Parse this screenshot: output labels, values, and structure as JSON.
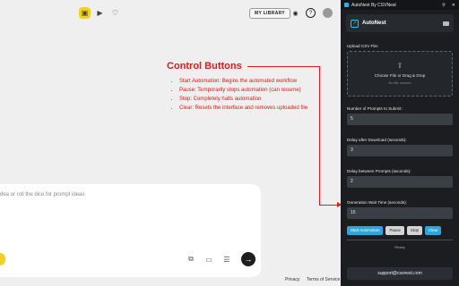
{
  "header": {
    "library_label": "MY LIBRARY"
  },
  "annotation": {
    "title": "Control Buttons",
    "items": [
      "Start Automation: Begins the automated workflow",
      "Pause: Temporarily stops automation (can resume)",
      "Stop: Completely halts automation",
      "Clear: Resets the interface and removes uploaded file"
    ],
    "color": "#e01b1b"
  },
  "prompt": {
    "placeholder": "dea or roll the dice for prompt ideas"
  },
  "footer": {
    "privacy": "Privacy",
    "terms": "Terms of Service"
  },
  "extension": {
    "window_title": "AutoNest By CSVNest",
    "brand": "AutoNest",
    "upload_label": "Upload CSV File:",
    "upload_text": "Choose File or Drag & Drop",
    "upload_sub": "No file chosen",
    "fields": [
      {
        "label": "Number of Prompts to Submit:",
        "value": "5"
      },
      {
        "label": "Delay after Download (seconds):",
        "value": "3"
      },
      {
        "label": "Delay between Prompts (seconds):",
        "value": "2"
      },
      {
        "label": "Generation Wait Time (seconds):",
        "value": "15"
      }
    ],
    "buttons": {
      "start": "Start Automation",
      "pause": "Pause",
      "stop": "Stop",
      "clear": "Clear"
    },
    "status": "Ready",
    "support": "support@csvnest.com",
    "accent": "#29a8de"
  }
}
